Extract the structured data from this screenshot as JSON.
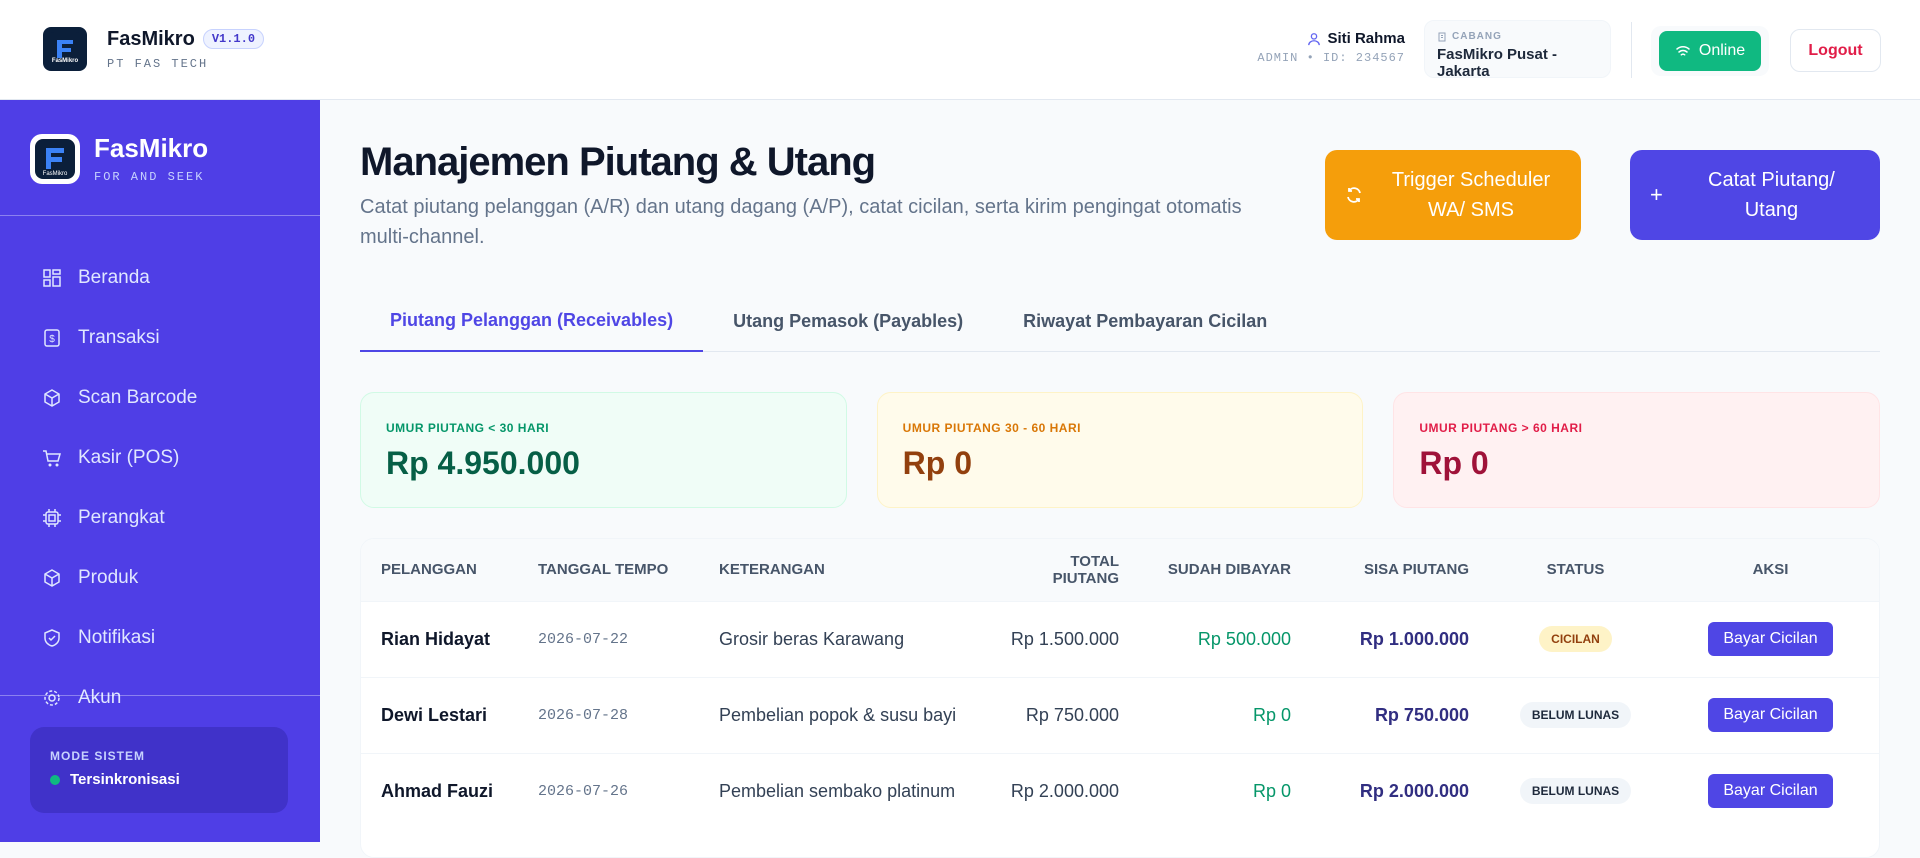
{
  "header": {
    "brand_name": "FasMikro",
    "version": "V1.1.0",
    "company": "PT FAS TECH",
    "user_name": "Siti Rahma",
    "user_role": "ADMIN • ID: 234567",
    "branch_label": "CABANG",
    "branch_name": "FasMikro Pusat - Jakarta",
    "online_label": "Online",
    "logout_label": "Logout"
  },
  "sidebar": {
    "brand_name": "FasMikro",
    "tagline": "FOR AND SEEK",
    "items": [
      {
        "label": "Beranda",
        "icon": "grid-icon"
      },
      {
        "label": "Transaksi",
        "icon": "receipt-icon"
      },
      {
        "label": "Scan Barcode",
        "icon": "box-icon"
      },
      {
        "label": "Kasir (POS)",
        "icon": "cart-icon"
      },
      {
        "label": "Perangkat",
        "icon": "chip-icon"
      },
      {
        "label": "Produk",
        "icon": "box-icon"
      },
      {
        "label": "Notifikasi",
        "icon": "shield-icon"
      },
      {
        "label": "Akun",
        "icon": "gear-icon"
      }
    ],
    "mode_label": "MODE SISTEM",
    "mode_status": "Tersinkronisasi"
  },
  "main": {
    "title": "Manajemen Piutang & Utang",
    "subtitle": "Catat piutang pelanggan (A/R) dan utang dagang (A/P), catat cicilan, serta kirim pengingat otomatis multi-channel.",
    "trigger_label": "Trigger Scheduler WA/ SMS",
    "add_label": "Catat Piutang/ Utang",
    "tabs": [
      {
        "label": "Piutang Pelanggan (Receivables)"
      },
      {
        "label": "Utang Pemasok (Payables)"
      },
      {
        "label": "Riwayat Pembayaran Cicilan"
      }
    ],
    "cards": [
      {
        "label": "UMUR PIUTANG < 30 HARI",
        "value": "Rp 4.950.000"
      },
      {
        "label": "UMUR PIUTANG 30 - 60 HARI",
        "value": "Rp 0"
      },
      {
        "label": "UMUR PIUTANG > 60 HARI",
        "value": "Rp 0"
      }
    ],
    "table": {
      "headers": [
        "PELANGGAN",
        "TANGGAL TEMPO",
        "KETERANGAN",
        "TOTAL PIUTANG",
        "SUDAH DIBAYAR",
        "SISA PIUTANG",
        "STATUS",
        "AKSI"
      ],
      "rows": [
        {
          "customer": "Rian Hidayat",
          "due": "2026-07-22",
          "note": "Grosir beras Karawang",
          "total": "Rp 1.500.000",
          "paid": "Rp 500.000",
          "remaining": "Rp 1.000.000",
          "status": "CICILAN",
          "action": "Bayar Cicilan"
        },
        {
          "customer": "Dewi Lestari",
          "due": "2026-07-28",
          "note": "Pembelian popok & susu bayi",
          "total": "Rp 750.000",
          "paid": "Rp 0",
          "remaining": "Rp 750.000",
          "status": "BELUM LUNAS",
          "action": "Bayar Cicilan"
        },
        {
          "customer": "Ahmad Fauzi",
          "due": "2026-07-26",
          "note": "Pembelian sembako platinum",
          "total": "Rp 2.000.000",
          "paid": "Rp 0",
          "remaining": "Rp 2.000.000",
          "status": "BELUM LUNAS",
          "action": "Bayar Cicilan"
        }
      ]
    }
  }
}
